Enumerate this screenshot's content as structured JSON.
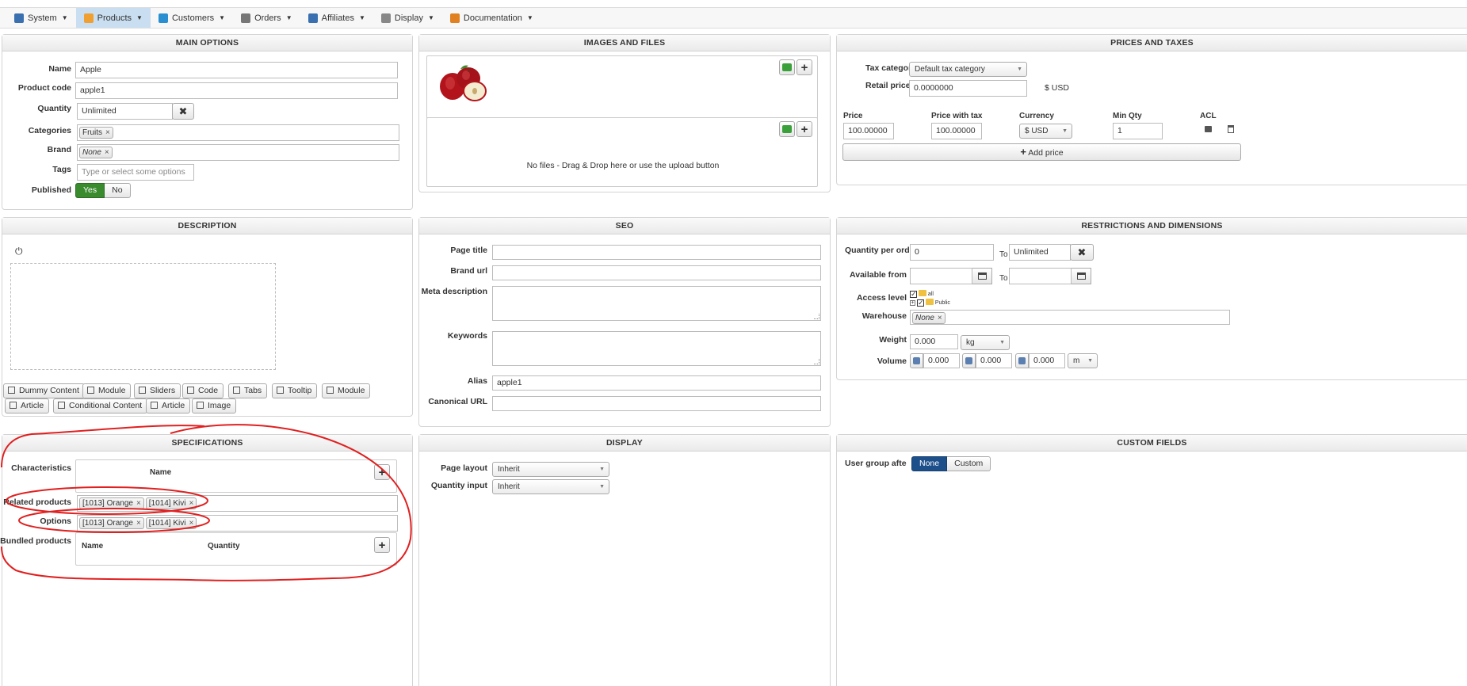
{
  "menu": [
    {
      "label": "System",
      "icon": "tools-icon",
      "color": "#3a6fb0"
    },
    {
      "label": "Products",
      "icon": "products-icon",
      "color": "#f0a030"
    },
    {
      "label": "Customers",
      "icon": "customers-icon",
      "color": "#2a8fd0"
    },
    {
      "label": "Orders",
      "icon": "orders-icon",
      "color": "#777777"
    },
    {
      "label": "Affiliates",
      "icon": "affiliates-icon",
      "color": "#3a6fb0"
    },
    {
      "label": "Display",
      "icon": "display-icon",
      "color": "#888888"
    },
    {
      "label": "Documentation",
      "icon": "documentation-icon",
      "color": "#e08020"
    }
  ],
  "main_options": {
    "title": "MAIN OPTIONS",
    "name_label": "Name",
    "name_value": "Apple",
    "code_label": "Product code",
    "code_value": "apple1",
    "quantity_label": "Quantity",
    "quantity_value": "Unlimited",
    "quantity_clear": "✖",
    "categories_label": "Categories",
    "categories": [
      "Fruits"
    ],
    "brand_label": "Brand",
    "brand": [
      "None"
    ],
    "tags_label": "Tags",
    "tags_placeholder": "Type or select some options",
    "published_label": "Published",
    "yes": "Yes",
    "no": "No"
  },
  "images": {
    "title": "IMAGES AND FILES",
    "no_files": "No files - Drag & Drop here or use the upload button",
    "plus": "+"
  },
  "prices": {
    "title": "PRICES AND TAXES",
    "tax_label": "Tax category",
    "tax_value": "Default tax category",
    "retail_label": "Retail price",
    "retail_value": "0.0000000",
    "retail_currency": "$ USD",
    "columns": {
      "price": "Price",
      "price_tax": "Price with tax",
      "currency": "Currency",
      "min_qty": "Min Qty",
      "acl": "ACL"
    },
    "row": {
      "price": "100.00000",
      "price_tax": "100.00000",
      "currency": "$ USD",
      "min_qty": "1"
    },
    "add_price": "Add price"
  },
  "description": {
    "title": "DESCRIPTION",
    "tools_row1": [
      "Dummy Content",
      "Module",
      "Sliders",
      "Code",
      "Tabs",
      "Tooltip",
      "Module"
    ],
    "tools_row2": [
      "Article",
      "Conditional Content",
      "Article",
      "Image"
    ]
  },
  "seo": {
    "title": "SEO",
    "page_title_label": "Page title",
    "page_title_value": "",
    "brand_url_label": "Brand url",
    "brand_url_value": "",
    "meta_label": "Meta description",
    "keywords_label": "Keywords",
    "alias_label": "Alias",
    "alias_value": "apple1",
    "canonical_label": "Canonical URL",
    "canonical_value": ""
  },
  "restrictions": {
    "title": "RESTRICTIONS AND DIMENSIONS",
    "qty_per_order_label": "Quantity per order",
    "qty_from": "0",
    "to": "To",
    "qty_to": "Unlimited",
    "clear": "✖",
    "available_label": "Available from",
    "date_from": "",
    "date_to": "",
    "access_label": "Access level",
    "access_all": "all",
    "access_public": "Public",
    "warehouse_label": "Warehouse",
    "warehouse": [
      "None"
    ],
    "weight_label": "Weight",
    "weight_value": "0.000",
    "weight_unit": "kg",
    "volume_label": "Volume",
    "vol1": "0.000",
    "vol2": "0.000",
    "vol3": "0.000",
    "vol_unit": "m"
  },
  "specifications": {
    "title": "SPECIFICATIONS",
    "characteristics_label": "Characteristics",
    "name_col": "Name",
    "related_label": "Related products",
    "related": [
      "[1013] Orange",
      "[1014] Kivi"
    ],
    "options_label": "Options",
    "options": [
      "[1013] Orange",
      "[1014] Kivi"
    ],
    "bundled_label": "Bundled products",
    "bundled_name": "Name",
    "bundled_qty": "Quantity"
  },
  "display": {
    "title": "DISPLAY",
    "layout_label": "Page layout",
    "layout_value": "Inherit",
    "qty_input_label": "Quantity input",
    "qty_input_value": "Inherit"
  },
  "custom_fields": {
    "title": "CUSTOM FIELDS",
    "group_label": "User group after ...",
    "none": "None",
    "custom": "Custom"
  }
}
